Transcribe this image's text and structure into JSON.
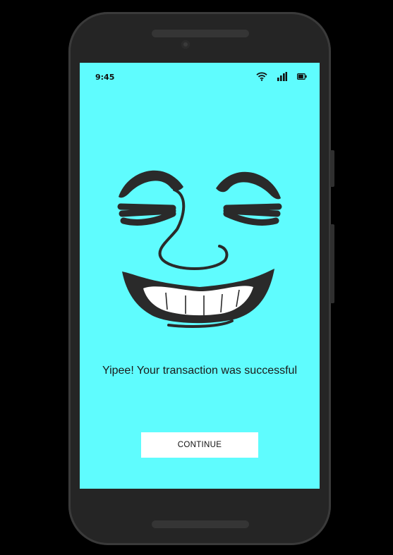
{
  "status_bar": {
    "time": "9:45",
    "icons": [
      "wifi-icon",
      "signal-icon",
      "battery-icon"
    ]
  },
  "illustration": {
    "name": "laughing-face-illustration"
  },
  "message": "Yipee! Your transaction was successful",
  "button": {
    "label": "CONTINUE"
  },
  "colors": {
    "screen_background": "#5ffcfe",
    "button_background": "#ffffff",
    "phone_frame": "#252525",
    "page_background": "#000000"
  }
}
